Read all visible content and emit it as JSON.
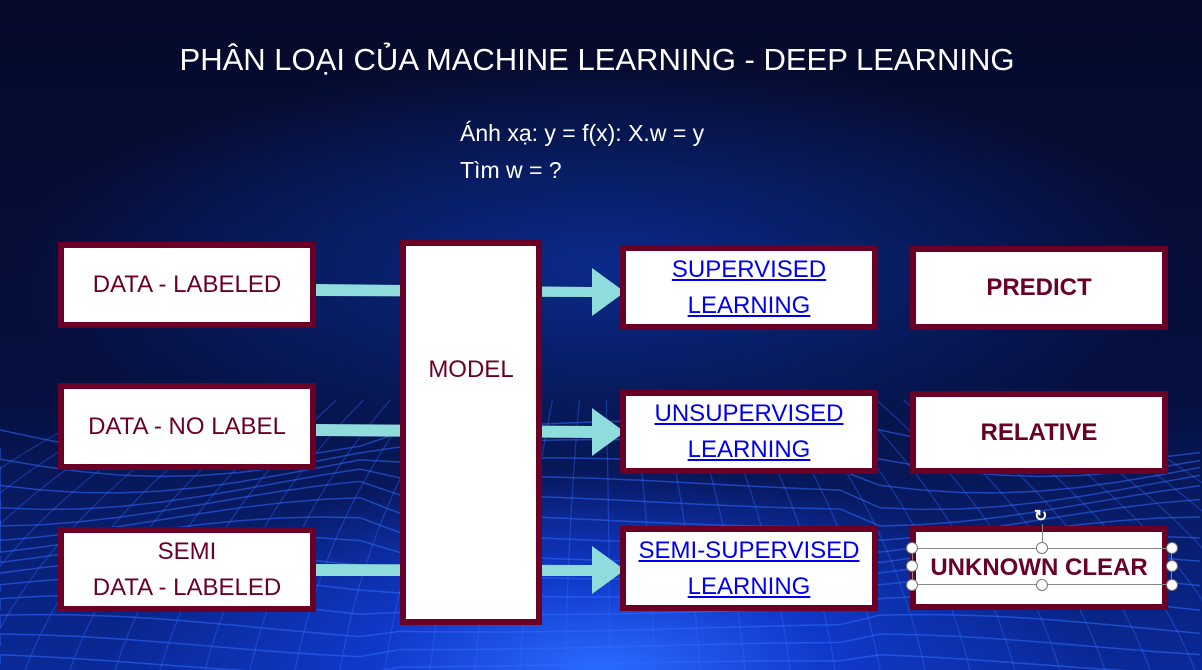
{
  "title": "PHÂN LOẠI CỦA MACHINE LEARNING - DEEP LEARNING",
  "subtitle": {
    "line1": "Ánh xạ: y = f(x): X.w = y",
    "line2": "Tìm w = ?"
  },
  "inputs": [
    {
      "l1": "DATA - LABELED",
      "l2": ""
    },
    {
      "l1": "DATA - NO LABEL",
      "l2": ""
    },
    {
      "l1": "SEMI",
      "l2": "DATA - LABELED"
    }
  ],
  "model": "MODEL",
  "learning": [
    {
      "l1": "SUPERVISED",
      "l2": "LEARNING"
    },
    {
      "l1": "UNSUPERVISED",
      "l2": "LEARNING"
    },
    {
      "l1": "SEMI-SUPERVISED",
      "l2": "LEARNING"
    }
  ],
  "results": [
    "PREDICT",
    "RELATIVE",
    "UNKNOWN CLEAR"
  ],
  "colors": {
    "border": "#6b0027",
    "arrow": "#8fdcdc",
    "link": "#0000ee"
  }
}
